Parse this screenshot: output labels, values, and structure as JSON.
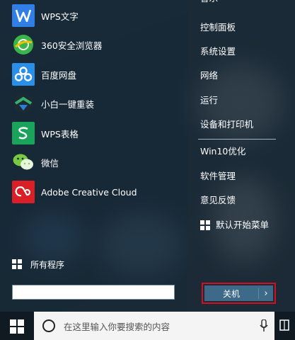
{
  "apps": [
    {
      "label": "WPS文字",
      "icon": "wps-writer-icon"
    },
    {
      "label": "360安全浏览器",
      "icon": "360-browser-icon"
    },
    {
      "label": "百度网盘",
      "icon": "baidu-netdisk-icon"
    },
    {
      "label": "小白一键重装",
      "icon": "xiaobai-reinstall-icon"
    },
    {
      "label": "WPS表格",
      "icon": "wps-spreadsheet-icon"
    },
    {
      "label": "微信",
      "icon": "wechat-icon"
    },
    {
      "label": "Adobe Creative Cloud",
      "icon": "adobe-cc-icon"
    }
  ],
  "right_menu": {
    "top_partial": "音乐",
    "control_panel": "控制面板",
    "system_settings": "系统设置",
    "network": "网络",
    "run": "运行",
    "devices_printers": "设备和打印机",
    "win10_optimize": "Win10优化",
    "software_manager": "软件管理",
    "feedback": "意见反馈",
    "default_start_menu": "默认开始菜单"
  },
  "all_programs": "所有程序",
  "search_box": {
    "value": ""
  },
  "shutdown": {
    "label": "关机",
    "arrow": "›"
  },
  "taskbar": {
    "search_placeholder": "在这里输入你要搜索的内容"
  },
  "colors": {
    "accent": "#3d6a88",
    "highlight_border": "#d41020",
    "wps_blue": "#2f7fe6",
    "wps_green": "#1aa35a"
  }
}
